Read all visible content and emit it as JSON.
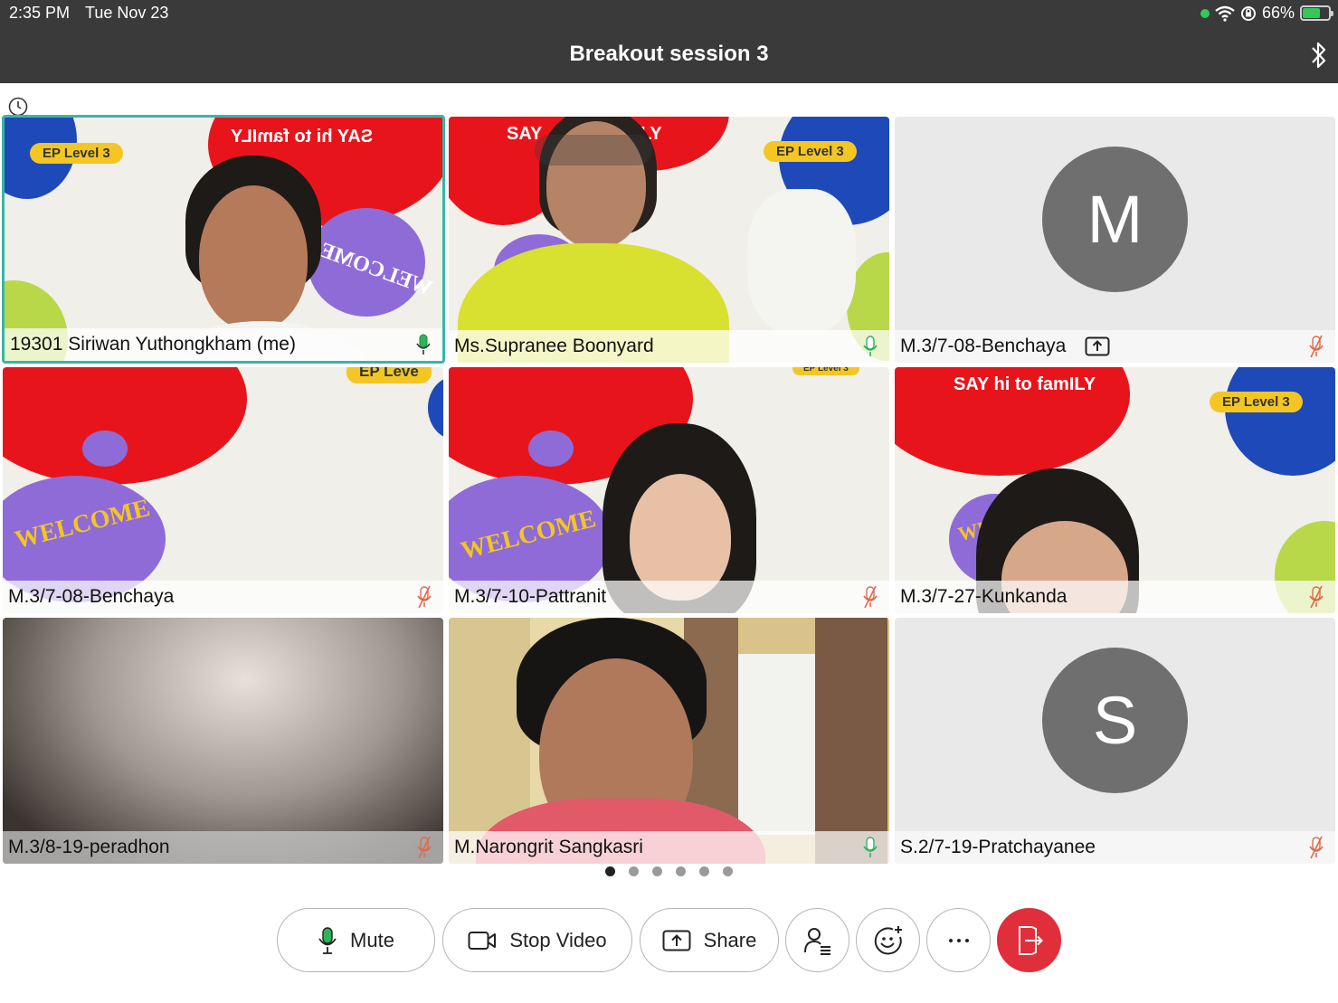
{
  "status": {
    "time": "2:35 PM",
    "date": "Tue Nov 23",
    "battery": "66%",
    "battery_level": 0.66
  },
  "header": {
    "title": "Breakout session 3"
  },
  "participants": [
    {
      "name": "19301 Siriwan Yuthongkham (me)",
      "mic": "on",
      "active": true,
      "banner": "SAY hi to famILY",
      "badge": "EP Level 3",
      "welcome": "WELCOME"
    },
    {
      "name": "Ms.Supranee Boonyard",
      "mic": "on",
      "banner": "SAY",
      "banner2": "LY",
      "badge": "EP Level 3"
    },
    {
      "name": "M.3/7-08-Benchaya",
      "mic": "muted",
      "avatar": "M",
      "sharing": true
    },
    {
      "name": "M.3/7-08-Benchaya",
      "mic": "muted",
      "badge": "EP Leve",
      "welcome": "WELCOME"
    },
    {
      "name": "M.3/7-10-Pattranit",
      "mic": "muted",
      "badge": "EP Level 3",
      "welcome": "WELCOME"
    },
    {
      "name": "M.3/7-27-Kunkanda",
      "mic": "muted",
      "banner": "SAY hi to famILY",
      "badge": "EP Level 3",
      "welcome": "WE"
    },
    {
      "name": "M.3/8-19-peradhon",
      "mic": "muted"
    },
    {
      "name": "M.Narongrit Sangkasri",
      "mic": "on"
    },
    {
      "name": "S.2/7-19-Pratchayanee",
      "mic": "muted",
      "avatar": "S"
    }
  ],
  "pager": {
    "pages": 6,
    "current": 1
  },
  "controls": {
    "mute_label": "Mute",
    "stop_video_label": "Stop Video",
    "share_label": "Share"
  },
  "colors": {
    "accent_active": "#37b6a6",
    "leave": "#e02f3a",
    "mic_on": "#2fb35a",
    "mic_muted": "#e06a4a"
  }
}
